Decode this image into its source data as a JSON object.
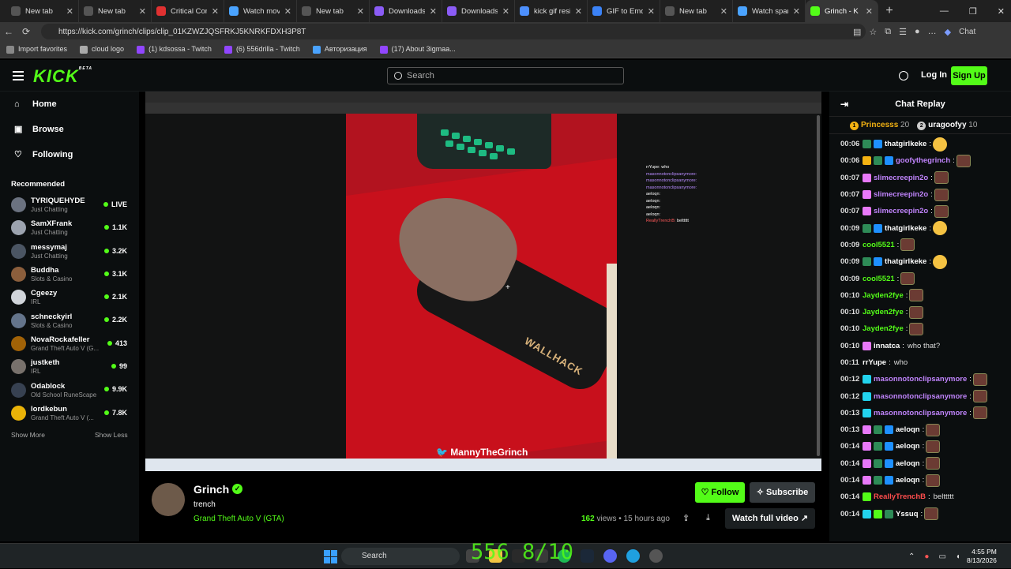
{
  "browser": {
    "tabs": [
      {
        "title": "New tab",
        "fav": "#555"
      },
      {
        "title": "New tab",
        "fav": "#555"
      },
      {
        "title": "Critical Conditio",
        "fav": "#e03131"
      },
      {
        "title": "Watch movie n",
        "fav": "#4aa3ff"
      },
      {
        "title": "New tab",
        "fav": "#555"
      },
      {
        "title": "Downloads | X",
        "fav": "#8b5cf6"
      },
      {
        "title": "Downloads | X",
        "fav": "#8b5cf6"
      },
      {
        "title": "kick gif resizer",
        "fav": "#4d90fe"
      },
      {
        "title": "GIF to Emote C",
        "fav": "#3b82f6"
      },
      {
        "title": "New tab",
        "fav": "#555"
      },
      {
        "title": "Watch spanky",
        "fav": "#4aa3ff"
      },
      {
        "title": "Grinch - K",
        "fav": "#53fc18"
      }
    ],
    "url": "https://kick.com/grinch/clips/clip_01KZWZJQSFRKJ5KNRKFDXH3P8T",
    "chat_btn": "Chat",
    "bookmarks": [
      {
        "label": "Import favorites",
        "color": "#888"
      },
      {
        "label": "cloud logo",
        "color": "#aaa"
      },
      {
        "label": "(1) kdsossa - Twitch",
        "color": "#9146ff"
      },
      {
        "label": "(6) 556drilla - Twitch",
        "color": "#9146ff"
      },
      {
        "label": "Авторизация",
        "color": "#4aa3ff"
      },
      {
        "label": "(17) About 3igmaa...",
        "color": "#9146ff"
      }
    ]
  },
  "kick": {
    "logo": "KICK",
    "beta": "BETA",
    "search_placeholder": "Search",
    "login": "Log In",
    "signup": "Sign Up"
  },
  "sidebar": {
    "nav": [
      {
        "label": "Home",
        "icon": "home-icon",
        "glyph": "⌂"
      },
      {
        "label": "Browse",
        "icon": "browse-icon",
        "glyph": "▣"
      },
      {
        "label": "Following",
        "icon": "heart-icon",
        "glyph": "♡"
      }
    ],
    "recommended_title": "Recommended",
    "channels": [
      {
        "name": "TYRIQUEHYDE",
        "category": "Just Chatting",
        "viewers": "LIVE"
      },
      {
        "name": "SamXFrank",
        "category": "Just Chatting",
        "viewers": "1.1K"
      },
      {
        "name": "messymaj",
        "category": "Just Chatting",
        "viewers": "3.2K"
      },
      {
        "name": "Buddha",
        "category": "Slots & Casino",
        "viewers": "3.1K"
      },
      {
        "name": "Cgeezy",
        "category": "IRL",
        "viewers": "2.1K"
      },
      {
        "name": "schneckyirl",
        "category": "Slots & Casino",
        "viewers": "2.2K"
      },
      {
        "name": "NovaRockafeller",
        "category": "Grand Theft Auto V (G...",
        "viewers": "413"
      },
      {
        "name": "justketh",
        "category": "IRL",
        "viewers": "99"
      },
      {
        "name": "Odablock",
        "category": "Old School RuneScape",
        "viewers": "9.9K"
      },
      {
        "name": "lordkebun",
        "category": "Grand Theft Auto V (...",
        "viewers": "7.8K"
      }
    ],
    "show_more": "Show More",
    "show_less": "Show Less"
  },
  "video": {
    "watermark": "🐦 MannyTheGrinch",
    "wallhack": "WALLHACK",
    "inner_chat": [
      {
        "user": "rrYupe:",
        "text": "who",
        "cls": ""
      },
      {
        "user": "masonnotonclipsanymore:",
        "text": "",
        "cls": "p"
      },
      {
        "user": "masonnotonclipsanymore:",
        "text": "",
        "cls": "p"
      },
      {
        "user": "masonnotonclipsanymore:",
        "text": "",
        "cls": "p"
      },
      {
        "user": "aeloqn:",
        "text": "",
        "cls": ""
      },
      {
        "user": "aeloqn:",
        "text": "",
        "cls": ""
      },
      {
        "user": "aeloqn:",
        "text": "",
        "cls": ""
      },
      {
        "user": "aeloqn:",
        "text": "",
        "cls": ""
      },
      {
        "user": "ReallyTrenchB:",
        "text": "belttttt",
        "cls": "r"
      }
    ]
  },
  "clip": {
    "channel": "Grinch",
    "title": "trench",
    "game": "Grand Theft Auto V (GTA)",
    "views": "162",
    "views_label": "views",
    "ago": "15 hours ago",
    "follow": "Follow",
    "subscribe": "Subscribe",
    "watch_full": "Watch full video"
  },
  "chat": {
    "title": "Chat Replay",
    "pinned": [
      {
        "rank": "1",
        "name": "Princesss",
        "points": "20",
        "gold": true
      },
      {
        "rank": "2",
        "name": "uragoofyy",
        "points": "10",
        "gold": false
      }
    ],
    "messages": [
      {
        "ts": "00:06",
        "user": "thatgirlkeke",
        "color": "#ffffff",
        "text": "",
        "emote": "emoji",
        "badges": [
          "#2e8b57",
          "#1e90ff"
        ]
      },
      {
        "ts": "00:06",
        "user": "goofythegrinch",
        "color": "#c084fc",
        "text": "",
        "emote": "emote",
        "badges": [
          "#f5b312",
          "#2e8b57",
          "#1e90ff"
        ]
      },
      {
        "ts": "00:07",
        "user": "slimecreepin2o",
        "color": "#c084fc",
        "text": "",
        "emote": "emote",
        "badges": [
          "#e879f9"
        ]
      },
      {
        "ts": "00:07",
        "user": "slimecreepin2o",
        "color": "#c084fc",
        "text": "",
        "emote": "emote",
        "badges": [
          "#e879f9"
        ]
      },
      {
        "ts": "00:07",
        "user": "slimecreepin2o",
        "color": "#c084fc",
        "text": "",
        "emote": "emote",
        "badges": [
          "#e879f9"
        ]
      },
      {
        "ts": "00:09",
        "user": "thatgirlkeke",
        "color": "#ffffff",
        "text": "",
        "emote": "emoji",
        "badges": [
          "#2e8b57",
          "#1e90ff"
        ]
      },
      {
        "ts": "00:09",
        "user": "cool5521",
        "color": "#53fc18",
        "text": "",
        "emote": "emote",
        "badges": []
      },
      {
        "ts": "00:09",
        "user": "thatgirlkeke",
        "color": "#ffffff",
        "text": "",
        "emote": "emoji",
        "badges": [
          "#2e8b57",
          "#1e90ff"
        ]
      },
      {
        "ts": "00:09",
        "user": "cool5521",
        "color": "#53fc18",
        "text": "",
        "emote": "emote",
        "badges": []
      },
      {
        "ts": "00:10",
        "user": "Jayden2fye",
        "color": "#53fc18",
        "text": "",
        "emote": "emote",
        "badges": []
      },
      {
        "ts": "00:10",
        "user": "Jayden2fye",
        "color": "#53fc18",
        "text": "",
        "emote": "emote",
        "badges": []
      },
      {
        "ts": "00:10",
        "user": "Jayden2fye",
        "color": "#53fc18",
        "text": "",
        "emote": "emote",
        "badges": []
      },
      {
        "ts": "00:10",
        "user": "innatca",
        "color": "#ffffff",
        "text": "who that?",
        "emote": "",
        "badges": [
          "#e879f9"
        ]
      },
      {
        "ts": "00:11",
        "user": "rrYupe",
        "color": "#ffffff",
        "text": "who",
        "emote": "",
        "badges": []
      },
      {
        "ts": "00:12",
        "user": "masonnotonclipsanymore",
        "color": "#c084fc",
        "text": "",
        "emote": "emote",
        "badges": [
          "#22d3ee"
        ]
      },
      {
        "ts": "00:12",
        "user": "masonnotonclipsanymore",
        "color": "#c084fc",
        "text": "",
        "emote": "emote",
        "badges": [
          "#22d3ee"
        ]
      },
      {
        "ts": "00:13",
        "user": "masonnotonclipsanymore",
        "color": "#c084fc",
        "text": "",
        "emote": "emote",
        "badges": [
          "#22d3ee"
        ]
      },
      {
        "ts": "00:13",
        "user": "aeloqn",
        "color": "#ffffff",
        "text": "",
        "emote": "emote",
        "badges": [
          "#e879f9",
          "#2e8b57",
          "#1e90ff"
        ]
      },
      {
        "ts": "00:14",
        "user": "aeloqn",
        "color": "#ffffff",
        "text": "",
        "emote": "emote",
        "badges": [
          "#e879f9",
          "#2e8b57",
          "#1e90ff"
        ]
      },
      {
        "ts": "00:14",
        "user": "aeloqn",
        "color": "#ffffff",
        "text": "",
        "emote": "emote",
        "badges": [
          "#e879f9",
          "#2e8b57",
          "#1e90ff"
        ]
      },
      {
        "ts": "00:14",
        "user": "aeloqn",
        "color": "#ffffff",
        "text": "",
        "emote": "emote",
        "badges": [
          "#e879f9",
          "#2e8b57",
          "#1e90ff"
        ]
      },
      {
        "ts": "00:14",
        "user": "ReallyTrenchB",
        "color": "#ff4d4d",
        "text": "belttttt",
        "emote": "",
        "badges": [
          "#53fc18"
        ]
      },
      {
        "ts": "00:14",
        "user": "Yssuq",
        "color": "#ffffff",
        "text": "",
        "emote": "emote",
        "badges": [
          "#22d3ee",
          "#53fc18",
          "#2e8b57"
        ]
      }
    ]
  },
  "taskbar": {
    "search": "Search",
    "overlay": "556 8/10",
    "time": "4:55 PM",
    "date": "8/13/2026"
  }
}
